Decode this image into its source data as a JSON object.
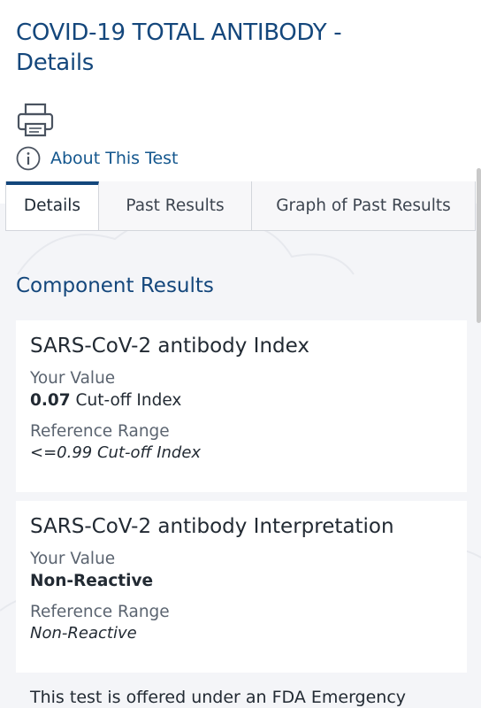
{
  "page": {
    "title_line1": "COVID-19 TOTAL ANTIBODY -",
    "title_line2": "Details"
  },
  "actions": {
    "print_icon": "printer-icon",
    "about_icon": "info-icon",
    "about_label": "About This Test"
  },
  "tabs": [
    {
      "label": "Details",
      "active": true
    },
    {
      "label": "Past Results",
      "active": false
    },
    {
      "label": "Graph of Past Results",
      "active": false
    }
  ],
  "section": {
    "title": "Component Results"
  },
  "components": [
    {
      "name": "SARS-CoV-2 antibody Index",
      "your_value_label": "Your Value",
      "value": "0.07",
      "unit": "Cut-off Index",
      "reference_label": "Reference Range",
      "reference": "<=0.99 Cut-off Index"
    },
    {
      "name": "SARS-CoV-2 antibody Interpretation",
      "your_value_label": "Your Value",
      "value": "Non-Reactive",
      "unit": "",
      "reference_label": "Reference Range",
      "reference": "Non-Reactive"
    }
  ],
  "footer": {
    "text": "This test is offered under an FDA Emergency"
  },
  "colors": {
    "title_blue": "#14477c",
    "link_blue": "#14578e",
    "background_gray": "#f4f5f8"
  }
}
